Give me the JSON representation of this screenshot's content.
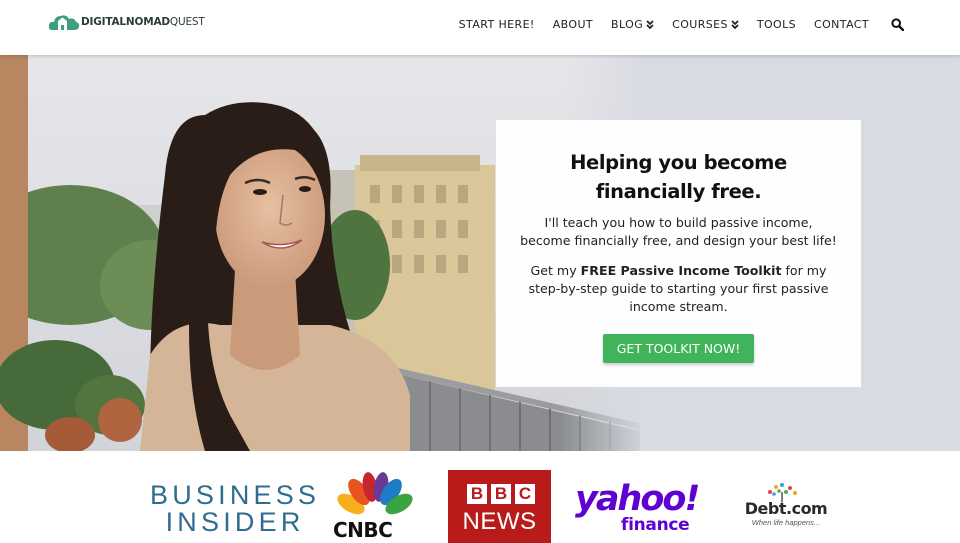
{
  "header": {
    "logo_bold": "DIGITALNOMAD",
    "logo_light": "QUEST",
    "nav": [
      {
        "label": "START HERE!",
        "dropdown": false
      },
      {
        "label": "ABOUT",
        "dropdown": false
      },
      {
        "label": "BLOG",
        "dropdown": true
      },
      {
        "label": "COURSES",
        "dropdown": true
      },
      {
        "label": "TOOLS",
        "dropdown": false
      },
      {
        "label": "CONTACT",
        "dropdown": false
      }
    ],
    "search_icon": "search-icon"
  },
  "hero": {
    "headline": "Helping you become financially free.",
    "intro": "I'll teach you how to build passive income, become financially free, and design your best life!",
    "offer_prefix": "Get my ",
    "offer_bold": "FREE Passive Income Toolkit",
    "offer_suffix": " for my step-by-step guide to starting your first passive income stream.",
    "cta_label": "GET TOOLKIT NOW!",
    "cta_color": "#3fb45a"
  },
  "press": {
    "business_insider_line1": "BUSINESS",
    "business_insider_line2": "INSIDER",
    "cnbc": "CNBC",
    "bbc_b1": "B",
    "bbc_b2": "B",
    "bbc_c": "C",
    "bbc_news": "NEWS",
    "yahoo": "yahoo!",
    "yahoo_sub": "finance",
    "debt": "Debt.com",
    "debt_tagline": "When life happens...",
    "colors": {
      "business_insider": "#2f6c8f",
      "bbc": "#b91b1b",
      "yahoo": "#5f01d1"
    }
  }
}
